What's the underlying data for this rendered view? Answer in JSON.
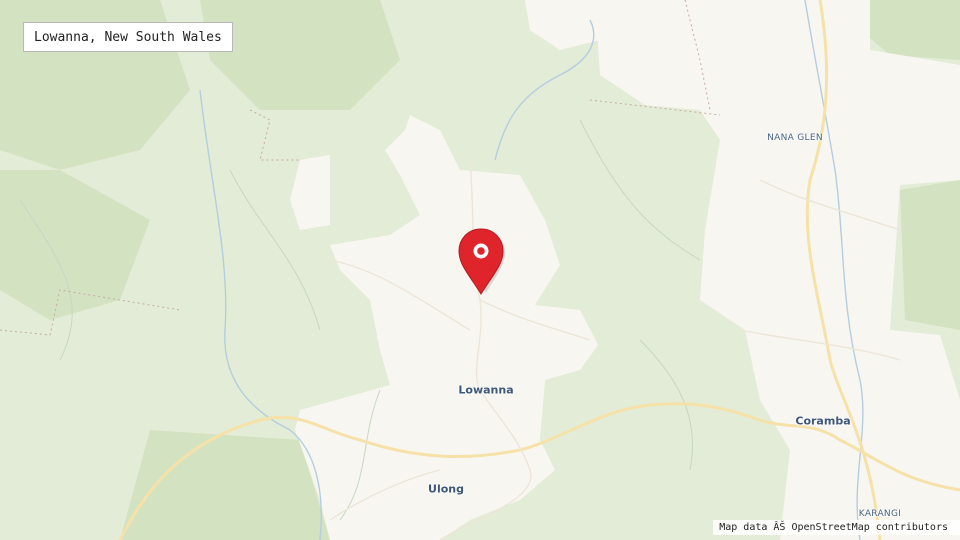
{
  "map": {
    "title": "Lowanna, New South Wales",
    "attribution": "Map data ÂŠ OpenStreetMap contributors",
    "marker_icon": "map-pin-icon",
    "places": [
      {
        "id": "nana-glen",
        "name": "NANA GLEN"
      },
      {
        "id": "lowanna",
        "name": "Lowanna"
      },
      {
        "id": "coramba",
        "name": "Coramba"
      },
      {
        "id": "ulong",
        "name": "Ulong"
      },
      {
        "id": "karangi",
        "name": "KARANGI"
      }
    ],
    "colors": {
      "forest": "#dbe7cb",
      "forest_dark": "#cddfbc",
      "cleared_land": "#f7f5f0",
      "road_major": "#fbe9b3",
      "river": "#a7c4dc",
      "marker": "#e0242b"
    }
  }
}
